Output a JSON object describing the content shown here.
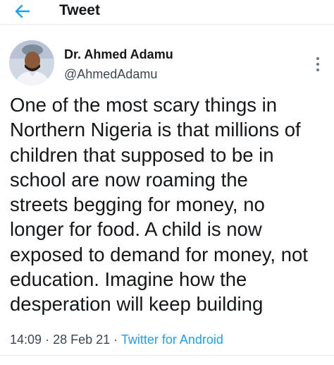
{
  "header": {
    "title": "Tweet",
    "back_icon": "arrow-left-icon",
    "accent_color": "#1da1f2"
  },
  "tweet": {
    "author_name": "Dr. Ahmed Adamu",
    "author_handle": "@AhmedAdamu",
    "more_icon": "more-vertical-icon",
    "text_lines": [
      "One of the most scary things in",
      "Northern Nigeria is that millions of",
      "children that supposed to be in",
      "school are now roaming the",
      "streets begging for money, no",
      "longer for food. A child is now",
      "exposed to demand for money, not",
      "education. Imagine how the",
      "desperation will keep building"
    ],
    "time": "14:09",
    "date": "28 Feb 21",
    "separator": "·",
    "source": "Twitter for Android"
  }
}
